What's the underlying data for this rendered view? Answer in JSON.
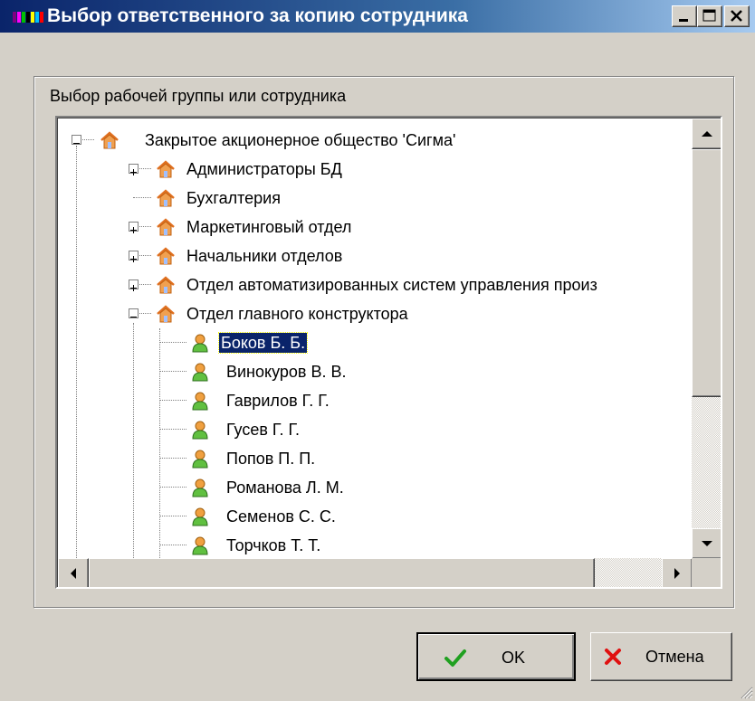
{
  "window": {
    "title": "Выбор ответственного за копию сотрудника",
    "controls": [
      "minimize",
      "maximize",
      "close"
    ]
  },
  "group": {
    "label": "Выбор рабочей группы или сотрудника"
  },
  "tree": {
    "root": {
      "label": "Закрытое акционерное общество 'Сигма'",
      "icon": "house-icon",
      "expanded": true
    },
    "groups": [
      {
        "label": "Администраторы БД",
        "icon": "house-icon",
        "expandable": true,
        "expanded": false
      },
      {
        "label": "Бухгалтерия",
        "icon": "house-icon",
        "expandable": false,
        "expanded": false
      },
      {
        "label": "Маркетинговый отдел",
        "icon": "house-icon",
        "expandable": true,
        "expanded": false
      },
      {
        "label": "Начальники отделов",
        "icon": "house-icon",
        "expandable": true,
        "expanded": false
      },
      {
        "label": "Отдел автоматизированных систем управления произ",
        "icon": "house-icon",
        "expandable": true,
        "expanded": false
      },
      {
        "label": "Отдел главного конструктора",
        "icon": "house-icon",
        "expandable": true,
        "expanded": true
      }
    ],
    "employees": [
      {
        "label": "Боков Б. Б.",
        "icon": "person-icon",
        "selected": true
      },
      {
        "label": "Винокуров В. В.",
        "icon": "person-icon",
        "selected": false
      },
      {
        "label": "Гаврилов Г. Г.",
        "icon": "person-icon",
        "selected": false
      },
      {
        "label": "Гусев Г. Г.",
        "icon": "person-icon",
        "selected": false
      },
      {
        "label": "Попов П. П.",
        "icon": "person-icon",
        "selected": false
      },
      {
        "label": "Романова Л. М.",
        "icon": "person-icon",
        "selected": false
      },
      {
        "label": "Семенов С. С.",
        "icon": "person-icon",
        "selected": false
      },
      {
        "label": "Торчков Т. Т.",
        "icon": "person-icon",
        "selected": false
      }
    ]
  },
  "buttons": {
    "ok": {
      "label": "OK",
      "icon": "checkmark-icon"
    },
    "cancel": {
      "label": "Отмена",
      "icon": "cross-icon"
    }
  },
  "colors": {
    "title_start": "#0a246a",
    "title_end": "#a6caf0",
    "selection": "#0a246a",
    "face": "#d4d0c8"
  }
}
